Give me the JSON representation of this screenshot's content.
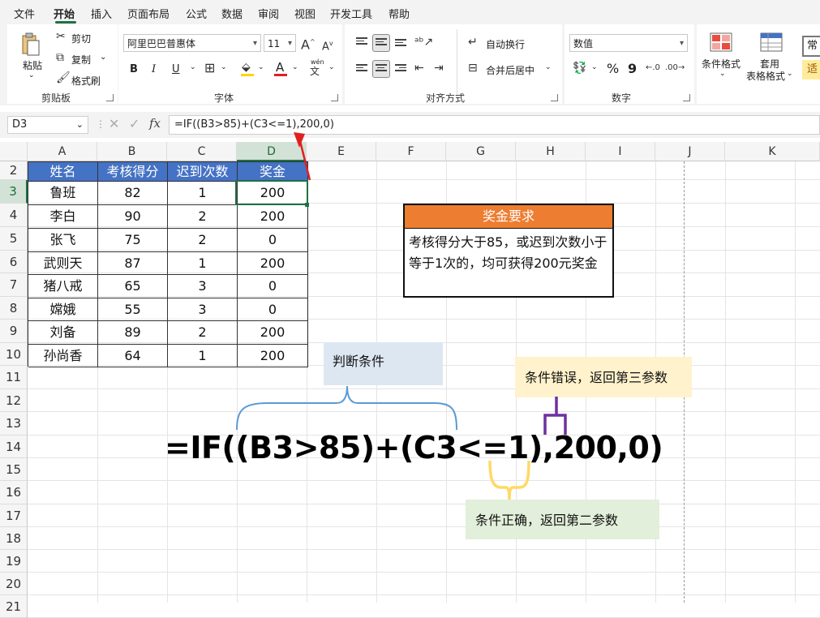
{
  "menu": {
    "items": [
      "文件",
      "开始",
      "插入",
      "页面布局",
      "公式",
      "数据",
      "审阅",
      "视图",
      "开发工具",
      "帮助"
    ]
  },
  "ribbon": {
    "clipboard": {
      "paste": "粘贴",
      "cut": "剪切",
      "copy": "复制",
      "painter": "格式刷",
      "group": "剪贴板"
    },
    "font": {
      "name": "阿里巴巴普惠体",
      "size": "11",
      "bold": "B",
      "italic": "I",
      "underline": "U",
      "color_a": "A",
      "wen": "wén",
      "group": "字体"
    },
    "align": {
      "wrap": "自动换行",
      "merge": "合并后居中",
      "group": "对齐方式"
    },
    "number": {
      "format": "数值",
      "percent": "%",
      "comma": "9",
      "group": "数字"
    },
    "styles": {
      "cond": "条件格式",
      "table_line1": "套用",
      "table_line2": "表格格式",
      "normal": "常",
      "fit": "适"
    },
    "colors": {
      "accent": "#1e7145",
      "font_red": "#e02020",
      "fill_yellow": "#ffd400"
    }
  },
  "formula_bar": {
    "cell_ref": "D3",
    "fx": "fx",
    "formula": "=IF((B3>85)+(C3<=1),200,0)"
  },
  "grid": {
    "columns": [
      "A",
      "B",
      "C",
      "D",
      "E",
      "F",
      "G",
      "H",
      "I",
      "J",
      "K"
    ],
    "rows": [
      "2",
      "3",
      "4",
      "5",
      "6",
      "7",
      "8",
      "9",
      "10",
      "11",
      "12",
      "13",
      "14",
      "15",
      "16",
      "17",
      "18",
      "19",
      "20",
      "21"
    ],
    "header_color": "#4472c4",
    "selected_column": "D",
    "selected_row": "3"
  },
  "table": {
    "headers": [
      "姓名",
      "考核得分",
      "迟到次数",
      "奖金"
    ],
    "rows": [
      [
        "鲁班",
        "82",
        "1",
        "200"
      ],
      [
        "李白",
        "90",
        "2",
        "200"
      ],
      [
        "张飞",
        "75",
        "2",
        "0"
      ],
      [
        "武则天",
        "87",
        "1",
        "200"
      ],
      [
        "猪八戒",
        "65",
        "3",
        "0"
      ],
      [
        "嫦娥",
        "55",
        "3",
        "0"
      ],
      [
        "刘备",
        "89",
        "2",
        "200"
      ],
      [
        "孙尚香",
        "64",
        "1",
        "200"
      ]
    ]
  },
  "requirement": {
    "title": "奖金要求",
    "body": "考核得分大于85，或迟到次数小于等于1次的，均可获得200元奖金",
    "title_color": "#ed7d31"
  },
  "annotations": {
    "big_formula": "=IF((B3>85)+(C3<=1),200,0)",
    "condition_label": "判断条件",
    "false_label": "条件错误，返回第三参数",
    "true_label": "条件正确，返回第二参数",
    "condition_bg": "#dde7f2",
    "false_bg": "#fff2cc",
    "true_bg": "#e2efda"
  }
}
